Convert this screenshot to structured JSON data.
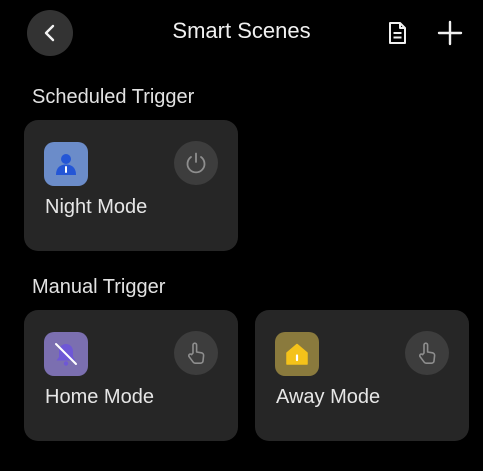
{
  "header": {
    "title": "Smart Scenes",
    "back_icon": "chevron-left-icon",
    "doc_icon": "document-icon",
    "add_icon": "plus-icon"
  },
  "sections": {
    "scheduled": {
      "label": "Scheduled Trigger",
      "cards": [
        {
          "label": "Night Mode",
          "icon": "person-icon",
          "action_icon": "power-icon",
          "icon_bg": "#6b8cc9",
          "icon_fg": "#2456d6"
        }
      ]
    },
    "manual": {
      "label": "Manual Trigger",
      "cards": [
        {
          "label": "Home Mode",
          "icon": "alarm-off-icon",
          "action_icon": "hand-tap-icon",
          "icon_bg": "#7b6fb0",
          "icon_fg": "#6e57d6"
        },
        {
          "label": "Away Mode",
          "icon": "home-icon",
          "action_icon": "hand-tap-icon",
          "icon_bg": "#8a7a3d",
          "icon_fg": "#f4c21a"
        }
      ]
    }
  },
  "colors": {
    "background": "#000000",
    "card": "#262626",
    "action_button": "#3d3d3d"
  }
}
